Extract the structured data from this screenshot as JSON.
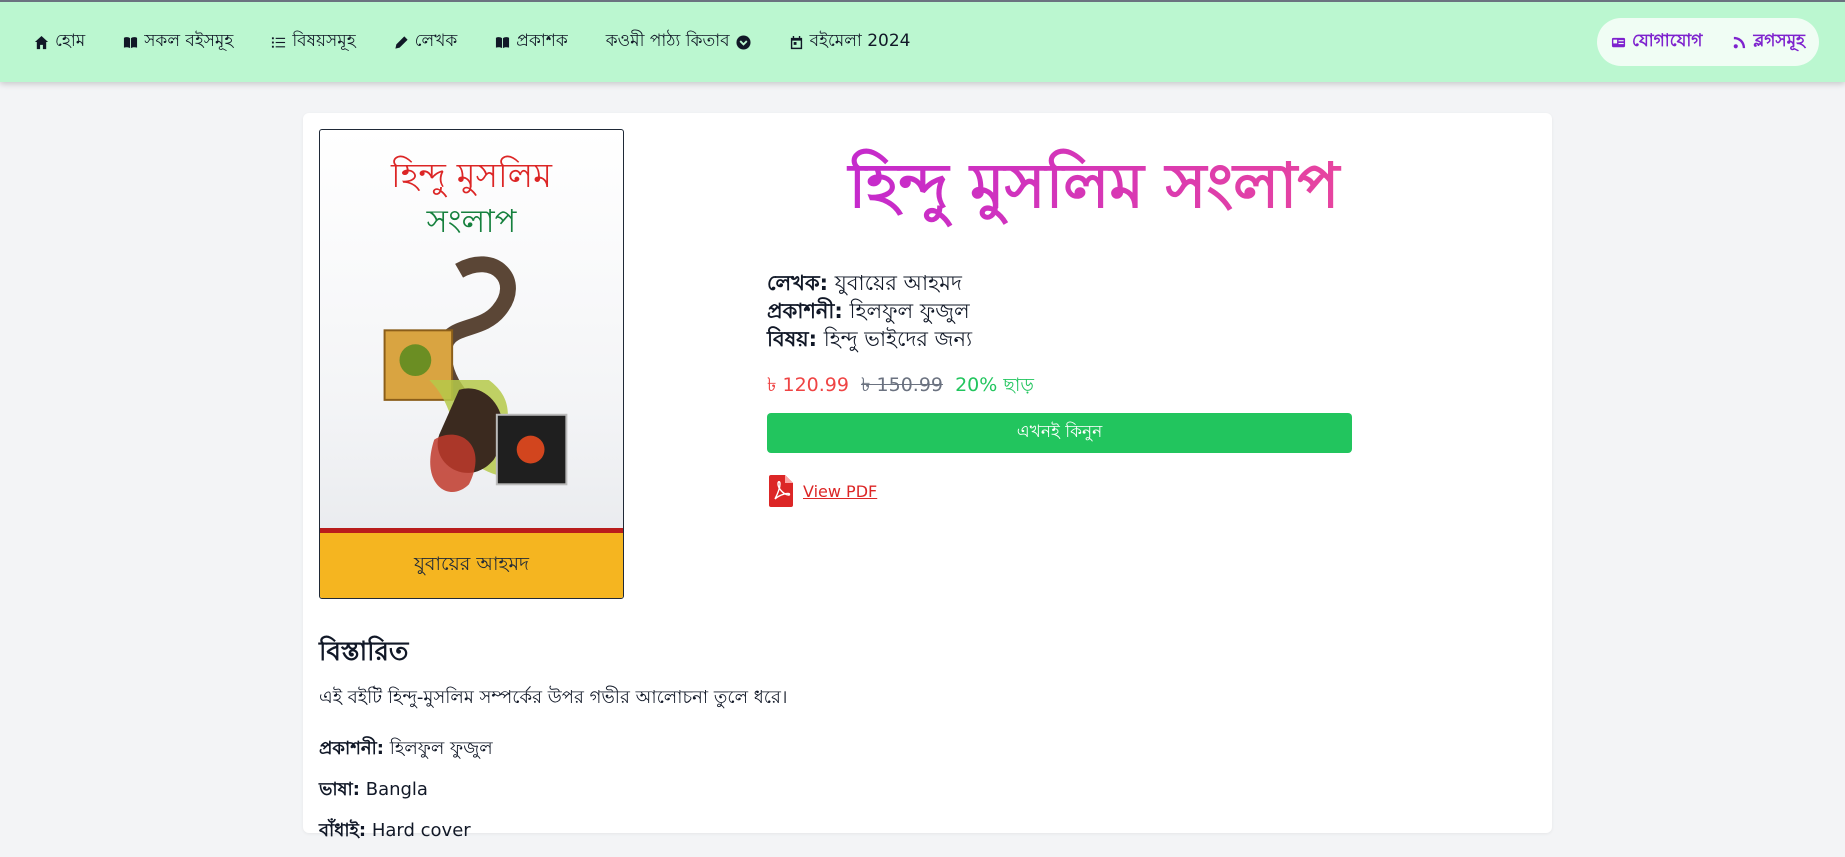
{
  "nav": {
    "items": [
      {
        "label": "হোম",
        "icon": "home-icon"
      },
      {
        "label": "সকল বইসমূহ",
        "icon": "book-open-icon"
      },
      {
        "label": "বিষয়সমূহ",
        "icon": "list-icon"
      },
      {
        "label": "লেখক",
        "icon": "pen-icon"
      },
      {
        "label": "প্রকাশক",
        "icon": "book-open-icon"
      },
      {
        "label": "কওমী পাঠ্য কিতাব",
        "icon": "chevron-down-circle-icon"
      },
      {
        "label": "বইমেলা 2024",
        "icon": "calendar-icon"
      }
    ],
    "right": [
      {
        "label": "যোগাযোগ",
        "icon": "contact-card-icon"
      },
      {
        "label": "ব্লগসমূহ",
        "icon": "blog-icon"
      }
    ]
  },
  "book": {
    "cover_title_line1": "হিন্দু মুসলিম",
    "cover_title_line2": "সংলাপ",
    "cover_author": "যুবায়ের আহমদ",
    "title": "হিন্দু মুসলিম সংলাপ",
    "author_label": "লেখক:",
    "author": "যুবায়ের আহমদ",
    "publisher_label": "প্রকাশনী:",
    "publisher": "হিলফুল ফুজুল",
    "subject_label": "বিষয়:",
    "subject": "হিন্দু ভাইদের জন্য",
    "price_now": "৳ 120.99",
    "price_old": "৳ 150.99",
    "discount": "20% ছাড়",
    "buy_label": "এখনই কিনুন",
    "pdf_label": "View PDF"
  },
  "details": {
    "heading": "বিস্তারিত",
    "description": "এই বইটি হিন্দু-মুসলিম সম্পর্কের উপর গভীর আলোচনা তুলে ধরে।",
    "publisher_label": "প্রকাশনী:",
    "publisher": "হিলফুল ফুজুল",
    "language_label": "ভাষা:",
    "language": "Bangla",
    "binding_label": "বাঁধাই:",
    "binding": "Hard cover"
  },
  "colors": {
    "nav_bg": "#bbf7d0",
    "accent_purple": "#7e22ce",
    "title_gradient_start": "#c026d3",
    "title_gradient_end": "#ec4899",
    "price": "#ef4444",
    "discount": "#22c55e",
    "buy_button": "#22c55e",
    "pdf": "#dc2626"
  }
}
